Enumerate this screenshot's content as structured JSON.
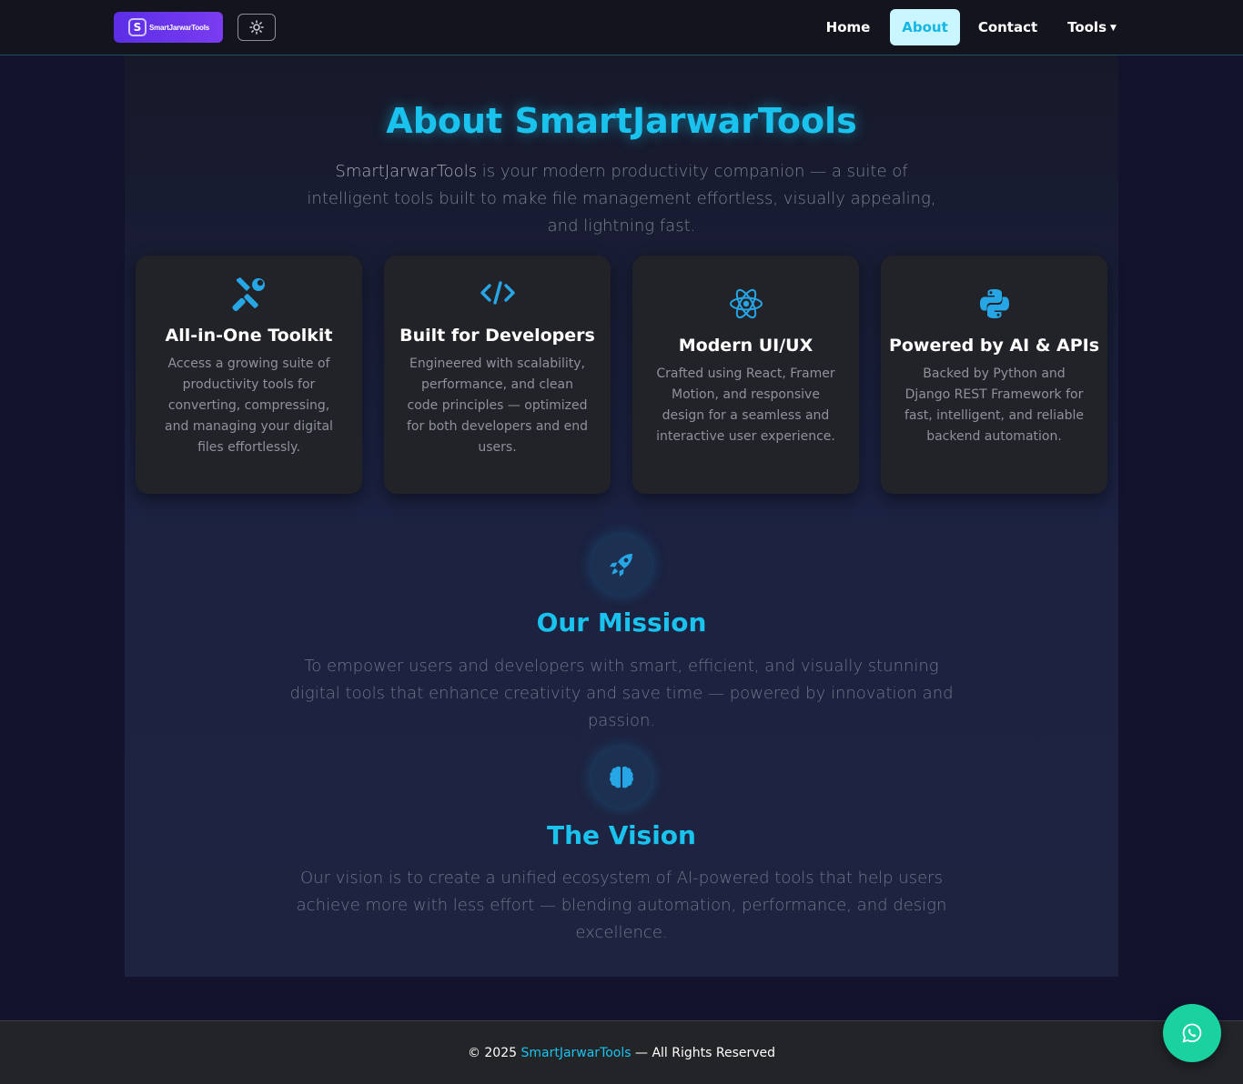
{
  "brand": {
    "logo_letter": "S",
    "name": "SmartJarwarTools"
  },
  "nav": {
    "theme_icon": "sun-icon",
    "links": [
      {
        "label": "Home",
        "active": false
      },
      {
        "label": "About",
        "active": true
      },
      {
        "label": "Contact",
        "active": false
      },
      {
        "label": "Tools",
        "active": false,
        "dropdown": true
      }
    ]
  },
  "hero": {
    "title": "About SmartJarwarTools",
    "brand_highlight": "SmartJarwarTools",
    "text": " is your modern productivity companion — a suite of intelligent tools built to make file management effortless, visually appealing, and lightning fast."
  },
  "cards": [
    {
      "icon": "tools-icon",
      "title": "All-in-One Toolkit",
      "text": "Access a growing suite of productivity tools for converting, compressing, and managing your digital files effortlessly."
    },
    {
      "icon": "code-icon",
      "title": "Built for Developers",
      "text": "Engineered with scalability, performance, and clean code principles — optimized for both developers and end users."
    },
    {
      "icon": "react-icon",
      "title": "Modern UI/UX",
      "text": "Crafted using React, Framer Motion, and responsive design for a seamless and interactive user experience."
    },
    {
      "icon": "python-icon",
      "title": "Powered by AI & APIs",
      "text": "Backed by Python and Django REST Framework for fast, intelligent, and reliable backend automation."
    }
  ],
  "mission": {
    "icon": "rocket-icon",
    "title": "Our Mission",
    "text": "To empower users and developers with smart, efficient, and visually stunning digital tools that enhance creativity and save time — powered by innovation and passion."
  },
  "vision": {
    "icon": "brain-icon",
    "title": "The Vision",
    "text": "Our vision is to create a unified ecosystem of AI-powered tools that help users achieve more with less effort — blending automation, performance, and design excellence."
  },
  "footer": {
    "prefix": "© 2025 ",
    "brand": "SmartJarwarTools",
    "suffix": " — All Rights Reserved"
  },
  "whatsapp": {
    "icon": "whatsapp-icon"
  },
  "colors": {
    "accent": "#19c3ee",
    "brand_purple": "#5b2ee6",
    "whatsapp": "#1ad2a0"
  }
}
